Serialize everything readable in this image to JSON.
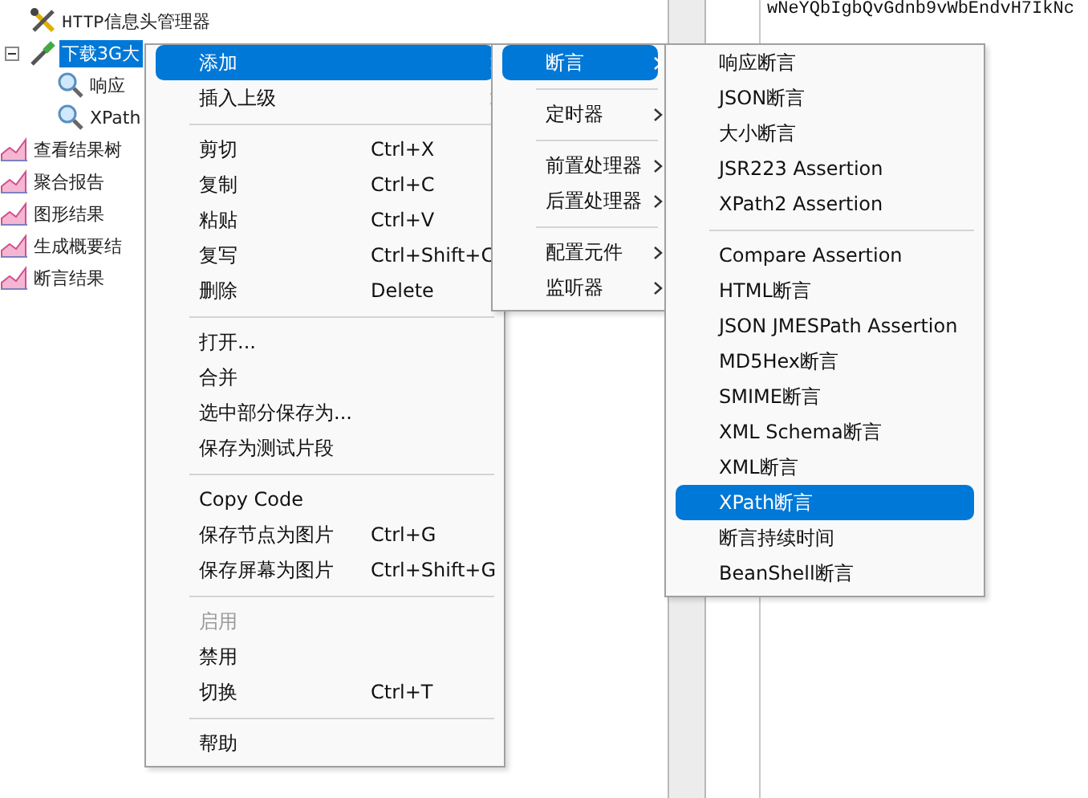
{
  "editor_text": "wNeYQbIgbQvGdnb9vWbEndvH7IkNc",
  "tree": {
    "items": [
      {
        "kind": "branch",
        "children": [
          {
            "kind": "config",
            "label": "HTTP信息头管理器",
            "selected": false
          },
          {
            "kind": "sampler",
            "label": "下载3G大",
            "selected": true,
            "expanded": true,
            "children": [
              {
                "kind": "assertion",
                "label": "响应",
                "selected": false
              },
              {
                "kind": "assertion",
                "label": "XPath",
                "selected": false
              }
            ]
          }
        ]
      },
      {
        "kind": "listener",
        "label": "查看结果树",
        "selected": false
      },
      {
        "kind": "listener",
        "label": "聚合报告",
        "selected": false
      },
      {
        "kind": "listener",
        "label": "图形结果",
        "selected": false
      },
      {
        "kind": "listener",
        "label": "生成概要结",
        "selected": false
      },
      {
        "kind": "listener",
        "label": "断言结果",
        "selected": false
      }
    ]
  },
  "context_menus": [
    {
      "items": [
        {
          "kind": "item",
          "label": "添加",
          "submenu": true,
          "selected": true,
          "disabled": false
        },
        {
          "kind": "item",
          "label": "插入上级",
          "submenu": true,
          "selected": false,
          "disabled": false
        },
        {
          "kind": "separator"
        },
        {
          "kind": "item",
          "label": "剪切",
          "shortcut": "Ctrl+X",
          "submenu": false,
          "selected": false,
          "disabled": false
        },
        {
          "kind": "item",
          "label": "复制",
          "shortcut": "Ctrl+C",
          "submenu": false,
          "selected": false,
          "disabled": false
        },
        {
          "kind": "item",
          "label": "粘贴",
          "shortcut": "Ctrl+V",
          "submenu": false,
          "selected": false,
          "disabled": false
        },
        {
          "kind": "item",
          "label": "复写",
          "shortcut": "Ctrl+Shift+C",
          "submenu": false,
          "selected": false,
          "disabled": false
        },
        {
          "kind": "item",
          "label": "删除",
          "shortcut": "Delete",
          "submenu": false,
          "selected": false,
          "disabled": false
        },
        {
          "kind": "separator"
        },
        {
          "kind": "item",
          "label": "打开...",
          "submenu": false,
          "selected": false,
          "disabled": false
        },
        {
          "kind": "item",
          "label": "合并",
          "submenu": false,
          "selected": false,
          "disabled": false
        },
        {
          "kind": "item",
          "label": "选中部分保存为...",
          "submenu": false,
          "selected": false,
          "disabled": false
        },
        {
          "kind": "item",
          "label": "保存为测试片段",
          "submenu": false,
          "selected": false,
          "disabled": false
        },
        {
          "kind": "separator"
        },
        {
          "kind": "item",
          "label": "Copy Code",
          "submenu": false,
          "selected": false,
          "disabled": false
        },
        {
          "kind": "item",
          "label": "保存节点为图片",
          "shortcut": "Ctrl+G",
          "submenu": false,
          "selected": false,
          "disabled": false
        },
        {
          "kind": "item",
          "label": "保存屏幕为图片",
          "shortcut": "Ctrl+Shift+G",
          "submenu": false,
          "selected": false,
          "disabled": false
        },
        {
          "kind": "separator"
        },
        {
          "kind": "item",
          "label": "启用",
          "submenu": false,
          "selected": false,
          "disabled": true
        },
        {
          "kind": "item",
          "label": "禁用",
          "submenu": false,
          "selected": false,
          "disabled": false
        },
        {
          "kind": "item",
          "label": "切换",
          "shortcut": "Ctrl+T",
          "submenu": false,
          "selected": false,
          "disabled": false
        },
        {
          "kind": "separator"
        },
        {
          "kind": "item",
          "label": "帮助",
          "submenu": false,
          "selected": false,
          "disabled": false
        }
      ]
    },
    {
      "items": [
        {
          "kind": "item",
          "label": "断言",
          "submenu": true,
          "selected": true
        },
        {
          "kind": "separator"
        },
        {
          "kind": "item",
          "label": "定时器",
          "submenu": true,
          "selected": false
        },
        {
          "kind": "separator"
        },
        {
          "kind": "item",
          "label": "前置处理器",
          "submenu": true,
          "selected": false
        },
        {
          "kind": "item",
          "label": "后置处理器",
          "submenu": true,
          "selected": false
        },
        {
          "kind": "separator"
        },
        {
          "kind": "item",
          "label": "配置元件",
          "submenu": true,
          "selected": false
        },
        {
          "kind": "item",
          "label": "监听器",
          "submenu": true,
          "selected": false
        }
      ]
    },
    {
      "items": [
        {
          "kind": "item",
          "label": "响应断言",
          "submenu": false,
          "selected": false
        },
        {
          "kind": "item",
          "label": "JSON断言",
          "submenu": false,
          "selected": false
        },
        {
          "kind": "item",
          "label": "大小断言",
          "submenu": false,
          "selected": false
        },
        {
          "kind": "item",
          "label": "JSR223 Assertion",
          "submenu": false,
          "selected": false
        },
        {
          "kind": "item",
          "label": "XPath2 Assertion",
          "submenu": false,
          "selected": false
        },
        {
          "kind": "separator"
        },
        {
          "kind": "item",
          "label": "Compare Assertion",
          "submenu": false,
          "selected": false
        },
        {
          "kind": "item",
          "label": "HTML断言",
          "submenu": false,
          "selected": false
        },
        {
          "kind": "item",
          "label": "JSON JMESPath Assertion",
          "submenu": false,
          "selected": false
        },
        {
          "kind": "item",
          "label": "MD5Hex断言",
          "submenu": false,
          "selected": false
        },
        {
          "kind": "item",
          "label": "SMIME断言",
          "submenu": false,
          "selected": false
        },
        {
          "kind": "item",
          "label": "XML Schema断言",
          "submenu": false,
          "selected": false
        },
        {
          "kind": "item",
          "label": "XML断言",
          "submenu": false,
          "selected": false
        },
        {
          "kind": "item",
          "label": "XPath断言",
          "submenu": false,
          "selected": true
        },
        {
          "kind": "item",
          "label": "断言持续时间",
          "submenu": false,
          "selected": false
        },
        {
          "kind": "item",
          "label": "BeanShell断言",
          "submenu": false,
          "selected": false
        }
      ]
    }
  ]
}
